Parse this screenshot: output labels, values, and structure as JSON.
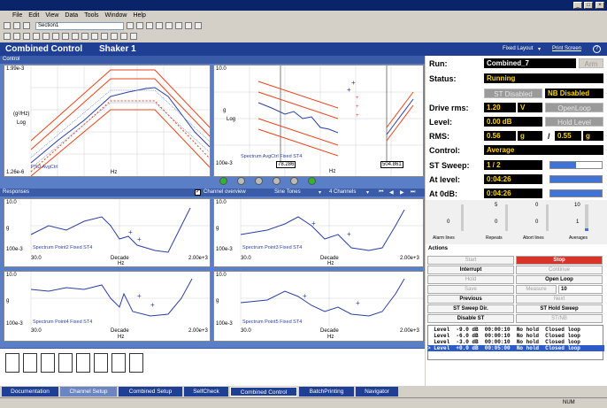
{
  "window": {
    "min": "_",
    "max": "□",
    "close": "×"
  },
  "menu": [
    "File",
    "Edit",
    "View",
    "Data",
    "Tools",
    "Window",
    "Help"
  ],
  "toolbar": {
    "section_combo": "Section1"
  },
  "header": {
    "title": "Combined Control",
    "subtitle": "Shaker 1",
    "layout": "Fixed Layout",
    "print": "Print Screen",
    "help": "?"
  },
  "control": {
    "label": "Control",
    "plot1": {
      "ymax": "1.99e-3",
      "ymin": "1.26e-6",
      "ylabel": "Log",
      "yunit": "(g²/Hz)",
      "xlabel": "Hz",
      "legend": "PSD AvgCtrl"
    },
    "plot2": {
      "ymax": "10.0",
      "ymin": "100e-3",
      "ylabel": "Log",
      "yunit": "g",
      "xlabel": "Hz",
      "legend": "Spectrum AvgCtrl Fixed ST4",
      "xleft": "78.286",
      "xright": "504.861"
    }
  },
  "responses": {
    "label": "Responses",
    "overview": "Channel overview",
    "mode": "Sine Tones",
    "channels": "4 Channels",
    "plots": [
      {
        "ymax": "10.0",
        "ymin": "100e-3",
        "xmin": "30.0",
        "xmax": "2.00e+3",
        "xlabel": "Decade",
        "xunit": "Hz",
        "yunit": "g",
        "legend": "Spectrum Point2 Fixed ST4"
      },
      {
        "ymax": "10.0",
        "ymin": "100e-3",
        "xmin": "30.0",
        "xmax": "2.00e+3",
        "xlabel": "Decade",
        "xunit": "Hz",
        "yunit": "g",
        "legend": "Spectrum Point3 Fixed ST4"
      },
      {
        "ymax": "10.0",
        "ymin": "100e-3",
        "xmin": "30.0",
        "xmax": "2.00e+3",
        "xlabel": "Decade",
        "xunit": "Hz",
        "yunit": "g",
        "legend": "Spectrum Point4 Fixed ST4"
      },
      {
        "ymax": "10.0",
        "ymin": "100e-3",
        "xmin": "30.0",
        "xmax": "2.00e+3",
        "xlabel": "Decade",
        "xunit": "Hz",
        "yunit": "g",
        "legend": "Spectrum Point5 Fixed ST4"
      }
    ]
  },
  "status": {
    "run_label": "Run:",
    "run_value": "Combined_7",
    "arm": "Arm",
    "status_label": "Status:",
    "status_value": "Running",
    "st_disabled": "ST Disabled",
    "nb_disabled": "NB Disabled",
    "drive_label": "Drive rms:",
    "drive_value": "1.20",
    "drive_unit": "V",
    "openloop": "OpenLoop",
    "level_label": "Level:",
    "level_value": "0.00 dB",
    "hold_level": "Hold Level",
    "rms_label": "RMS:",
    "rms_value": "0.56",
    "rms_unit": "g",
    "rms_sep": "/",
    "rms_value2": "0.55",
    "rms_unit2": "g",
    "control_label": "Control:",
    "control_value": "Average",
    "sweep_label": "ST Sweep:",
    "sweep_value": "1  /  2",
    "atlevel_label": "At level:",
    "atlevel_value": "0:04:26",
    "at0_label": "At 0dB:",
    "at0_value": "0:04:26"
  },
  "meters": [
    {
      "top": "",
      "value": "0",
      "label": "Alarm lines"
    },
    {
      "top": "5",
      "value": "0",
      "label": "Repeats"
    },
    {
      "top": "0",
      "value": "0",
      "label": "Abort lines"
    },
    {
      "top": "10",
      "value": "1",
      "label": "Averages"
    }
  ],
  "actions": {
    "label": "Actions",
    "start": "Start",
    "stop": "Stop",
    "interrupt": "Interrupt",
    "continue": "Continue",
    "hold": "Hold",
    "openloop": "Open Loop",
    "save": "Save",
    "measure": "Measure",
    "measure_value": "10",
    "previous": "Previous",
    "next": "Next",
    "sweep_dir": "ST Sweep Dir.",
    "hold_sweep": "ST Hold Sweep",
    "disable_st": "Disable ST",
    "stnb": "ST/NB"
  },
  "schedule": [
    "  Level  -9.0 dB  00:00:10  No hold  Closed loop",
    "  Level  -6.0 dB  00:00:10  No hold  Closed loop",
    "  Level  -3.0 dB  00:00:10  No hold  Closed loop",
    "> Level  +0.0 dB  00:05:00  No hold  Closed loop"
  ],
  "tabs": [
    "Documentation",
    "Channel Setup",
    "Combined Setup",
    "SelfCheck",
    "Combined Control",
    "BatchPrinting",
    "Navigator"
  ],
  "statusbar": {
    "num": "NUM"
  }
}
